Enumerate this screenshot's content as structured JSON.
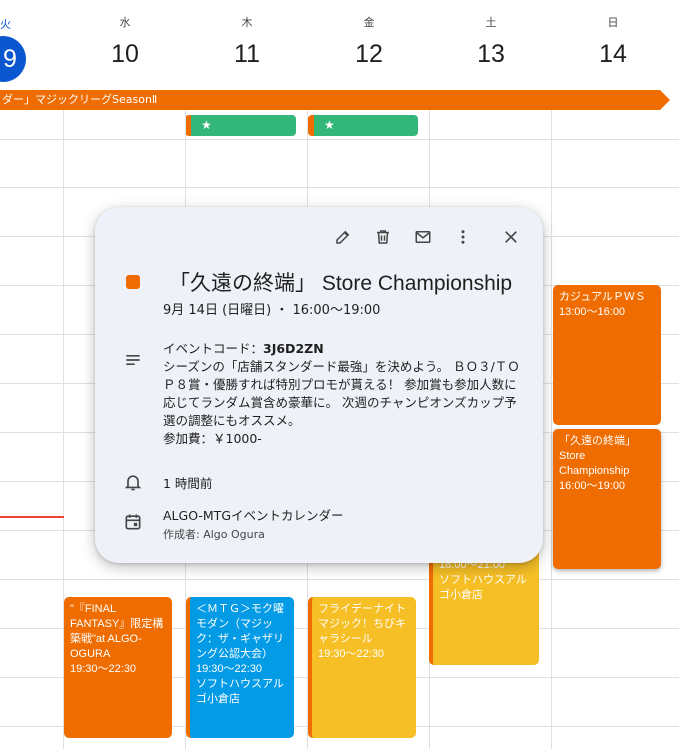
{
  "week": {
    "days": [
      {
        "name": "火",
        "num": "9",
        "today": true
      },
      {
        "name": "水",
        "num": "10"
      },
      {
        "name": "木",
        "num": "11"
      },
      {
        "name": "金",
        "num": "12"
      },
      {
        "name": "土",
        "num": "13"
      },
      {
        "name": "日",
        "num": "14"
      }
    ]
  },
  "allday": {
    "banner": "ダー」マジックリーグSeasonⅡ",
    "star_chips": [
      "★",
      "★"
    ]
  },
  "events": {
    "sun_casual": {
      "title": "カジュアルＰＷＳ",
      "time": "13:00～16:00"
    },
    "sun_store": {
      "title": "「久遠の終端」 Store Championship",
      "time": "16:00～19:00"
    },
    "sat_hidden": {
      "time": "18:00～21:00",
      "location": "ソフトハウスアルゴ小倉店"
    },
    "wed_ff": {
      "title": "\"『FINAL FANTASY』限定構築戦\"at ALGO-OGURA",
      "time": "19:30～22:30"
    },
    "thu_moku": {
      "title": "＜ＭＴＧ＞モク曜モダン（マジック：ザ・ギャザリング公認大会）",
      "time": "19:30～22:30",
      "location": "ソフトハウスアルゴ小倉店"
    },
    "fri_night": {
      "title": "フライデーナイトマジック！ちびキャラシール",
      "time": "19:30～22:30"
    }
  },
  "popup": {
    "title": "「久遠の終端」 Store Championship",
    "date": "9月 14日 (日曜日) ・ 16:00～19:00",
    "desc_code_label": "イベントコード：",
    "desc_code_value": "3J6D2ZN",
    "desc_body": "シーズンの「店舗スタンダード最強」を決めよう。 ＢＯ３/ＴＯＰ８賞・優勝すれば特別プロモが貰える！ 参加賞も参加人数に応じてランダム賞含め豪華に。 次週のチャンピオンズカップ予選の調整にもオススメ。",
    "desc_fee": "参加費：￥1000-",
    "reminder": "1 時間前",
    "calendar": "ALGO-MTGイベントカレンダー",
    "creator": "作成者: Algo Ogura",
    "color": "#ef6c00"
  },
  "colors": {
    "today": "#0b57d0",
    "orange": "#ef6c00",
    "green": "#33b679",
    "blue": "#039be5",
    "yellow": "#f6bf26"
  }
}
